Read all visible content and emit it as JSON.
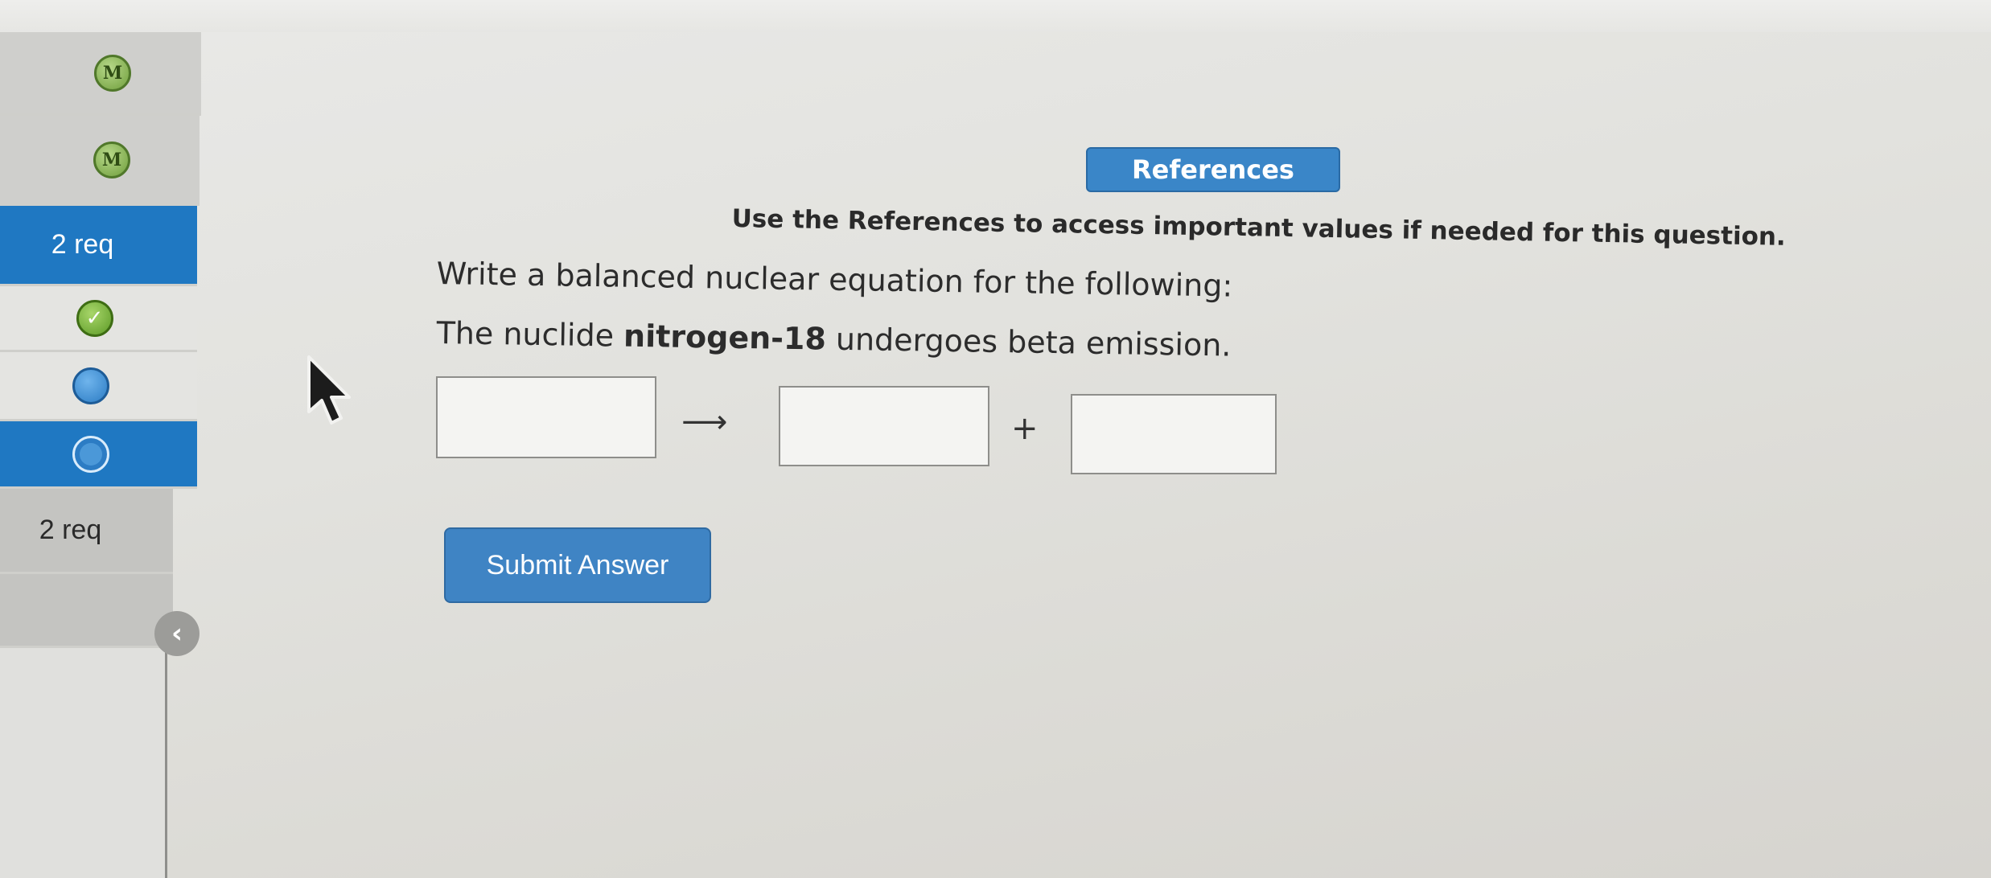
{
  "sidebar": {
    "items": [
      {
        "kind": "mastery-badge",
        "label": "M",
        "icon": "m-badge-icon"
      },
      {
        "kind": "mastery-badge",
        "label": "M",
        "icon": "m-badge-icon"
      },
      {
        "kind": "requirement",
        "label": "2 req",
        "active": true
      },
      {
        "kind": "status",
        "icon": "check-icon"
      },
      {
        "kind": "status",
        "icon": "blue-dot-icon"
      },
      {
        "kind": "status",
        "icon": "blue-ring-icon",
        "active": true
      },
      {
        "kind": "requirement",
        "label": "2 req"
      },
      {
        "kind": "empty"
      }
    ],
    "collapse_glyph": "‹"
  },
  "question": {
    "references_label": "References",
    "instructions": "Use the References to access important values if needed for this question.",
    "prompt": "Write a balanced nuclear equation for the following:",
    "problem_prefix": "The nuclide ",
    "problem_bold": "nitrogen-18",
    "problem_suffix": " undergoes beta emission.",
    "arrow": "⟶",
    "plus": "+",
    "answer_boxes": [
      "",
      "",
      ""
    ],
    "submit_label": "Submit Answer"
  },
  "colors": {
    "accent_blue": "#3a86c8",
    "sidebar_active": "#1f78c2",
    "badge_green": "#6f9e3c"
  }
}
